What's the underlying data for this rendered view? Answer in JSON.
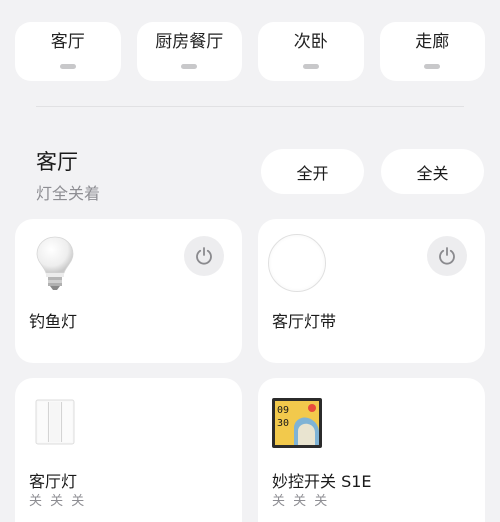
{
  "room_tabs": [
    {
      "label": "客厅"
    },
    {
      "label": "厨房餐厅"
    },
    {
      "label": "次卧"
    },
    {
      "label": "走廊"
    }
  ],
  "room": {
    "title": "客厅",
    "status": "灯全关着",
    "all_on_label": "全开",
    "all_off_label": "全关"
  },
  "devices": [
    {
      "name": "钓鱼灯",
      "icon": "light-bulb-icon",
      "has_power": true
    },
    {
      "name": "客厅灯带",
      "icon": "light-strip-icon",
      "has_power": true
    },
    {
      "name": "客厅灯",
      "icon": "wall-switch-icon",
      "sub": "关 关 关"
    },
    {
      "name": "妙控开关 S1E",
      "icon": "smart-panel-icon",
      "sub": "关 关 关",
      "panel_time_h": "09",
      "panel_time_m": "30"
    }
  ],
  "colors": {
    "background": "#f2f2f4",
    "card": "#ffffff",
    "muted": "#8e8e93",
    "power_bg": "#ededef"
  }
}
